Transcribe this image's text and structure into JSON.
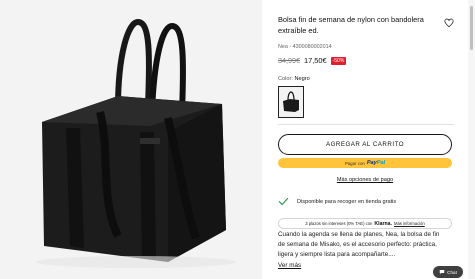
{
  "product": {
    "title": "Bolsa fin de semana de nylon con bandolera extraíble ed.",
    "reference": "Nea - 4300080002014",
    "old_price": "34,99€",
    "new_price": "17,50€",
    "discount": "-50%",
    "color_label": "Color: ",
    "color_value": "Negro"
  },
  "actions": {
    "add_to_cart": "AGREGAR AL CARRITO",
    "paypal_prefix": "Pagar con",
    "paypal_brand_pay": "Pay",
    "paypal_brand_pal": "Pal",
    "payment_options": "Más opciones de pago"
  },
  "pickup": {
    "text": "Disponible para recoger en tienda gratis"
  },
  "klarna": {
    "text": "3 plazos sin intereses (0% TAE) con",
    "brand": "Klarna.",
    "more": "Más información"
  },
  "description": {
    "text": "Cuando la agenda se llena de planes, Nea, la bolsa de fin de semana de Misako, es el accesorio perfecto: práctica, ligera y siempre lista para acompañarte....",
    "more_link": "Ver más"
  },
  "chat": {
    "label": "Chat"
  },
  "colors": {
    "discount_bg": "#e01f2e",
    "paypal_bg": "#ffc439",
    "check_green": "#2e9b4a"
  }
}
